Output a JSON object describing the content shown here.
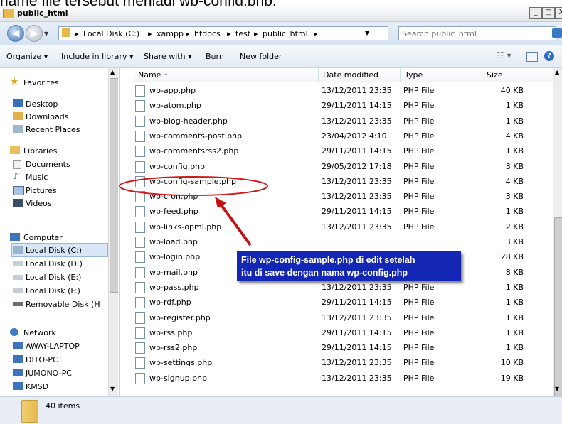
{
  "top_text": "name file tersebut menjadi wp-config.php.",
  "window": {
    "title": "public_html",
    "min_label": "_",
    "max_label": "□",
    "close_label": "X"
  },
  "address": {
    "crumbs": [
      "Local Disk (C:)",
      "xampp",
      "htdocs",
      "test",
      "public_html"
    ],
    "search_placeholder": "Search public_html"
  },
  "toolbar": {
    "organize": "Organize ▾",
    "include": "Include in library ▾",
    "share": "Share with ▾",
    "burn": "Burn",
    "newfolder": "New folder"
  },
  "sidebar": {
    "favorites": "Favorites",
    "fav_items": [
      "Desktop",
      "Downloads",
      "Recent Places"
    ],
    "libraries": "Libraries",
    "lib_items": [
      "Documents",
      "Music",
      "Pictures",
      "Videos"
    ],
    "computer": "Computer",
    "comp_items": [
      "Local Disk (C:)",
      "Local Disk (D:)",
      "Local Disk (E:)",
      "Local Disk (F:)",
      "Removable Disk (H"
    ],
    "network": "Network",
    "net_items": [
      "AWAY-LAPTOP",
      "DITO-PC",
      "JUMONO-PC",
      "KMSD"
    ]
  },
  "columns": {
    "name": "Name",
    "date": "Date modified",
    "type": "Type",
    "size": "Size"
  },
  "files": [
    {
      "name": "wp-app.php",
      "date": "13/12/2011 23:35",
      "type": "PHP File",
      "size": "40 KB"
    },
    {
      "name": "wp-atom.php",
      "date": "29/11/2011 14:15",
      "type": "PHP File",
      "size": "1 KB"
    },
    {
      "name": "wp-blog-header.php",
      "date": "13/12/2011 23:35",
      "type": "PHP File",
      "size": "1 KB"
    },
    {
      "name": "wp-comments-post.php",
      "date": "23/04/2012 4:10",
      "type": "PHP File",
      "size": "4 KB"
    },
    {
      "name": "wp-commentsrss2.php",
      "date": "29/11/2011 14:15",
      "type": "PHP File",
      "size": "1 KB"
    },
    {
      "name": "wp-config.php",
      "date": "29/05/2012 17:18",
      "type": "PHP File",
      "size": "3 KB"
    },
    {
      "name": "wp-config-sample.php",
      "date": "13/12/2011 23:35",
      "type": "PHP File",
      "size": "4 KB"
    },
    {
      "name": "wp-cron.php",
      "date": "13/12/2011 23:35",
      "type": "PHP File",
      "size": "3 KB"
    },
    {
      "name": "wp-feed.php",
      "date": "29/11/2011 14:15",
      "type": "PHP File",
      "size": "1 KB"
    },
    {
      "name": "wp-links-opml.php",
      "date": "13/12/2011 23:35",
      "type": "PHP File",
      "size": "2 KB"
    },
    {
      "name": "wp-load.php",
      "date": "",
      "type": "",
      "size": "3 KB"
    },
    {
      "name": "wp-login.php",
      "date": "",
      "type": "",
      "size": "28 KB"
    },
    {
      "name": "wp-mail.php",
      "date": "13/12/2011 23:35",
      "type": "PHP File",
      "size": "8 KB"
    },
    {
      "name": "wp-pass.php",
      "date": "13/12/2011 23:35",
      "type": "PHP File",
      "size": "1 KB"
    },
    {
      "name": "wp-rdf.php",
      "date": "29/11/2011 14:15",
      "type": "PHP File",
      "size": "1 KB"
    },
    {
      "name": "wp-register.php",
      "date": "13/12/2011 23:35",
      "type": "PHP File",
      "size": "1 KB"
    },
    {
      "name": "wp-rss.php",
      "date": "29/11/2011 14:15",
      "type": "PHP File",
      "size": "1 KB"
    },
    {
      "name": "wp-rss2.php",
      "date": "29/11/2011 14:15",
      "type": "PHP File",
      "size": "1 KB"
    },
    {
      "name": "wp-settings.php",
      "date": "13/12/2011 23:35",
      "type": "PHP File",
      "size": "10 KB"
    },
    {
      "name": "wp-signup.php",
      "date": "13/12/2011 23:35",
      "type": "PHP File",
      "size": "19 KB"
    }
  ],
  "callout": {
    "line1": "File wp-config-sample.php di edit setelah",
    "line2": "itu di save dengan nama wp-config.php"
  },
  "status": {
    "count": "40 items"
  }
}
